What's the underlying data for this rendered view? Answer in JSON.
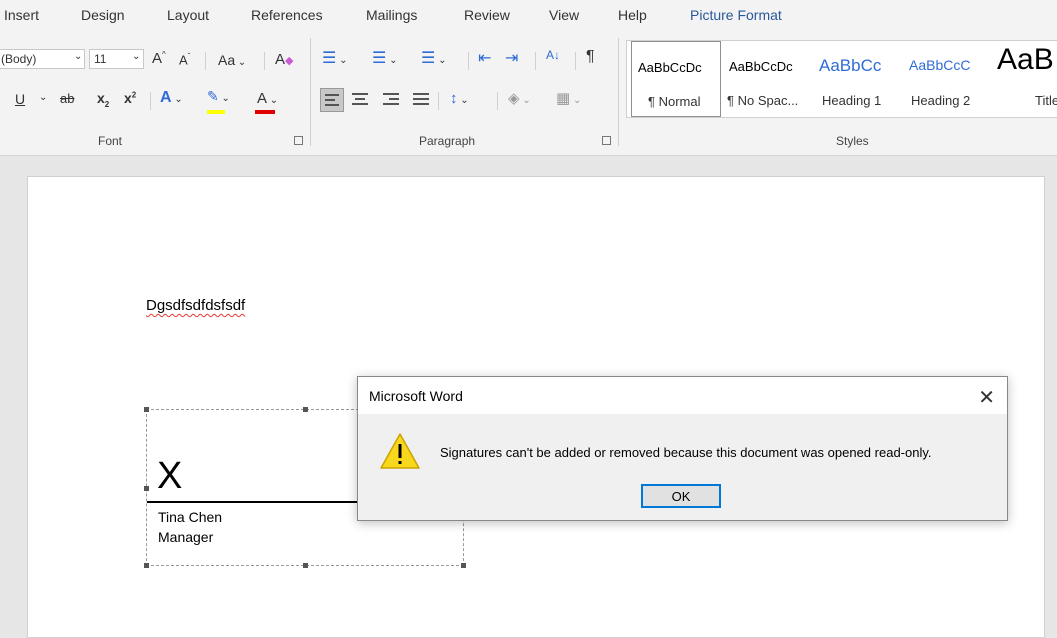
{
  "tabs": [
    "Insert",
    "Design",
    "Layout",
    "References",
    "Mailings",
    "Review",
    "View",
    "Help",
    "Picture Format"
  ],
  "font_group": {
    "font_name": "(Body)",
    "font_size": "11",
    "grow_label": "A",
    "shrink_label": "A",
    "case_label": "Aa",
    "underline_label": "U",
    "strike_label": "ab",
    "subscript_label": "x",
    "superscript_label": "x",
    "effects_label": "A",
    "font_color_label": "A",
    "label": "Font"
  },
  "paragraph_group": {
    "sort_label": "A",
    "pilcrow": "¶",
    "label": "Paragraph"
  },
  "styles_group": {
    "items": [
      {
        "preview": "AaBbCcDc",
        "name": "¶ Normal"
      },
      {
        "preview": "AaBbCcDc",
        "name": "¶ No Spac..."
      },
      {
        "preview": "AaBbCc",
        "name": "Heading 1"
      },
      {
        "preview": "AaBbCcC",
        "name": "Heading 2"
      },
      {
        "preview": "AaB",
        "name": "Title"
      }
    ],
    "label": "Styles"
  },
  "document": {
    "body_text": "Dgsdfsdfdsfsdf",
    "signature": {
      "x_mark": "X",
      "name": "Tina Chen",
      "title": "Manager"
    }
  },
  "dialog": {
    "title": "Microsoft Word",
    "message": "Signatures can't be added or removed because this document was opened read-only.",
    "ok_label": "OK",
    "close_glyph": "✕"
  },
  "colors": {
    "accent": "#2b579a",
    "highlight_yellow": "#ffff00",
    "font_color_red": "#e00000",
    "spell_underline": "#e53935",
    "warning_yellow": "#f9d71c",
    "ok_border": "#0078d7"
  }
}
